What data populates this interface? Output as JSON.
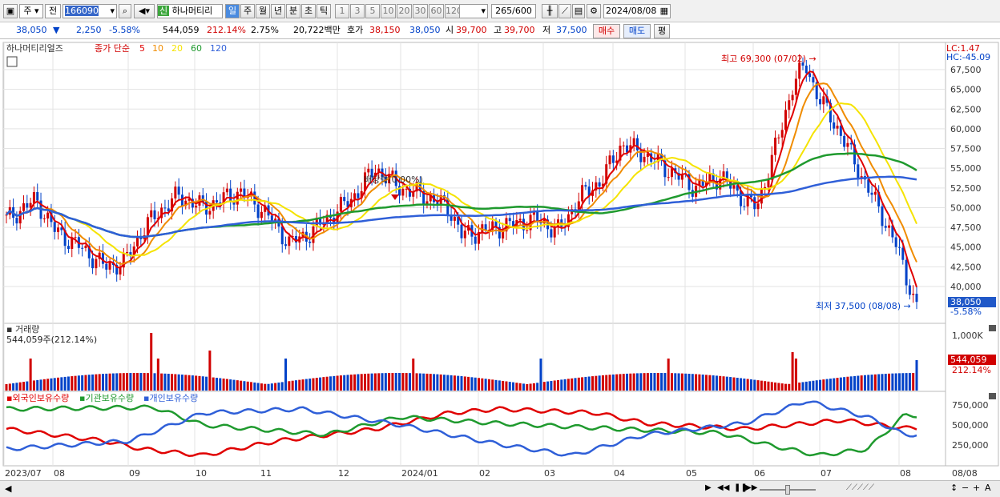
{
  "toolbar": {
    "market": "주",
    "prev": "전",
    "code": "166090",
    "new_badge": "신",
    "stock_name": "하나머티리",
    "periods": [
      "일",
      "주",
      "월",
      "년",
      "분",
      "초",
      "틱"
    ],
    "selected_period": "일",
    "intervals": [
      "1",
      "3",
      "5",
      "10",
      "20",
      "30",
      "60",
      "120"
    ],
    "count": "265",
    "count_total": "/600",
    "date": "2024/08/08"
  },
  "quote": {
    "price": "38,050",
    "price_arrow": "▼",
    "change": "2,250",
    "change_pct": "-5.58%",
    "volume": "544,059",
    "volume_ratio": "212.14%",
    "turnover_rate": "2.75%",
    "amount": "20,722백만",
    "ask_label": "호가",
    "ask": "38,150",
    "bid": "38,050",
    "open_label": "시",
    "open": "39,700",
    "high_label": "고",
    "high": "39,700",
    "low_label": "저",
    "low": "37,500",
    "buy_button": "매수",
    "sell_button": "매도",
    "eval_button": "평"
  },
  "price_panel": {
    "title": "하나머티리얼즈",
    "legend_prefix": "종가 단순",
    "ma_periods": [
      "5",
      "10",
      "20",
      "60",
      "120"
    ],
    "lc_label": "LC:1.47",
    "hc_label": "HC:-45.09",
    "high_annotation": "최고 69,300 (07/02)",
    "low_annotation": "최저 37,500 (08/08)",
    "dividend_annotation": "배당락(0.00%)",
    "current_price_tag": "38,050",
    "current_pct": "-5.58%",
    "y_ticks": [
      "67,500",
      "65,000",
      "62,500",
      "60,000",
      "57,500",
      "55,000",
      "52,500",
      "50,000",
      "47,500",
      "45,000",
      "42,500",
      "40,000"
    ]
  },
  "volume_panel": {
    "title": "거래량",
    "value_label": "544,059주(212.14%)",
    "y_tick": "1,000K",
    "current_tag": "544,059",
    "current_pct": "212.14%"
  },
  "holding_panel": {
    "legend": [
      "외국인보유수량",
      "기관보유수량",
      "개인보유수량"
    ],
    "y_ticks": [
      "750,000",
      "500,000",
      "250,000"
    ]
  },
  "x_axis": {
    "labels": [
      "2023/07",
      "08",
      "09",
      "10",
      "11",
      "12",
      "2024/01",
      "02",
      "03",
      "04",
      "05",
      "06",
      "07",
      "08"
    ],
    "right_label": "08/08"
  },
  "colors": {
    "up": "#d10000",
    "down": "#0041c8",
    "ma5": "#e00000",
    "ma10": "#f08c00",
    "ma20": "#f5e300",
    "ma60": "#1f9a2e",
    "ma120": "#2f5fd8",
    "foreign": "#e00000",
    "institution": "#1f9a2e",
    "individual": "#2f5fd8"
  },
  "chart_data": {
    "type": "candlestick",
    "title": "하나머티리얼즈",
    "x_range": [
      "2023/07",
      "2024/08/08"
    ],
    "ylim": [
      38000,
      69300
    ],
    "notable": {
      "high": {
        "value": 69300,
        "date": "07/02"
      },
      "low": {
        "value": 37500,
        "date": "08/08"
      },
      "last_close": 38050
    },
    "close_monthly": [
      {
        "x": "2023/07",
        "y": 48500
      },
      {
        "x": "2023/08",
        "y": 43000
      },
      {
        "x": "2023/09",
        "y": 50500
      },
      {
        "x": "2023/10",
        "y": 50000
      },
      {
        "x": "2023/11",
        "y": 50000
      },
      {
        "x": "2023/12",
        "y": 46500
      },
      {
        "x": "2024/01",
        "y": 53500
      },
      {
        "x": "2024/02",
        "y": 48000
      },
      {
        "x": "2024/03",
        "y": 48500
      },
      {
        "x": "2024/04",
        "y": 57000
      },
      {
        "x": "2024/05",
        "y": 53500
      },
      {
        "x": "2024/06",
        "y": 51500
      },
      {
        "x": "2024/07",
        "y": 58000
      },
      {
        "x": "2024/08",
        "y": 38050
      }
    ],
    "holdings_scale": [
      0,
      750000
    ]
  }
}
